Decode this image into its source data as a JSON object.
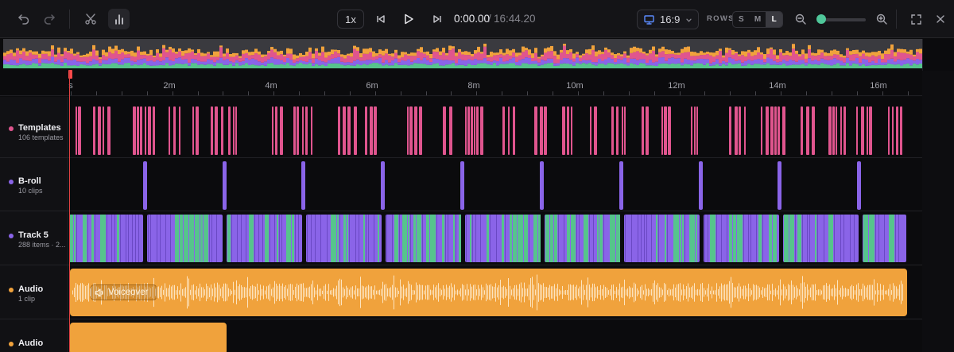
{
  "toolbar": {
    "undo_icon": "undo-icon",
    "redo_icon": "redo-icon",
    "split_icon": "scissors-icon",
    "waveform_icon": "bar-chart-icon",
    "speed": "1x",
    "time_current": "0:00.00",
    "time_separator": "/",
    "time_total": "16:44.20",
    "aspect": "16:9",
    "rows_label": "ROWS",
    "rows_options": [
      "S",
      "M",
      "L"
    ],
    "rows_selected": "L",
    "zoom_level": 0.1
  },
  "ruler": {
    "labels": [
      "s",
      "2m",
      "4m",
      "6m",
      "8m",
      "10m",
      "12m",
      "14m",
      "16m"
    ]
  },
  "tracks": [
    {
      "name": "Templates",
      "sub": "106 templates",
      "color": "#e0558e"
    },
    {
      "name": "B-roll",
      "sub": "10 clips",
      "color": "#8a64e8"
    },
    {
      "name": "Track 5",
      "sub": "288 items · 2...",
      "color": "#8a64e8"
    },
    {
      "name": "Audio",
      "sub": "1 clip",
      "color": "#f0a23c"
    },
    {
      "name": "Audio",
      "sub": "",
      "color": "#f0a23c"
    }
  ],
  "clips": {
    "voiceover_label": "Voiceover"
  },
  "colors": {
    "templates": "#e0558e",
    "broll": "#8a64e8",
    "track5_a": "#8a64e8",
    "track5_b": "#56c48c",
    "audio": "#f0a23c",
    "playhead": "#ff4a4a"
  }
}
